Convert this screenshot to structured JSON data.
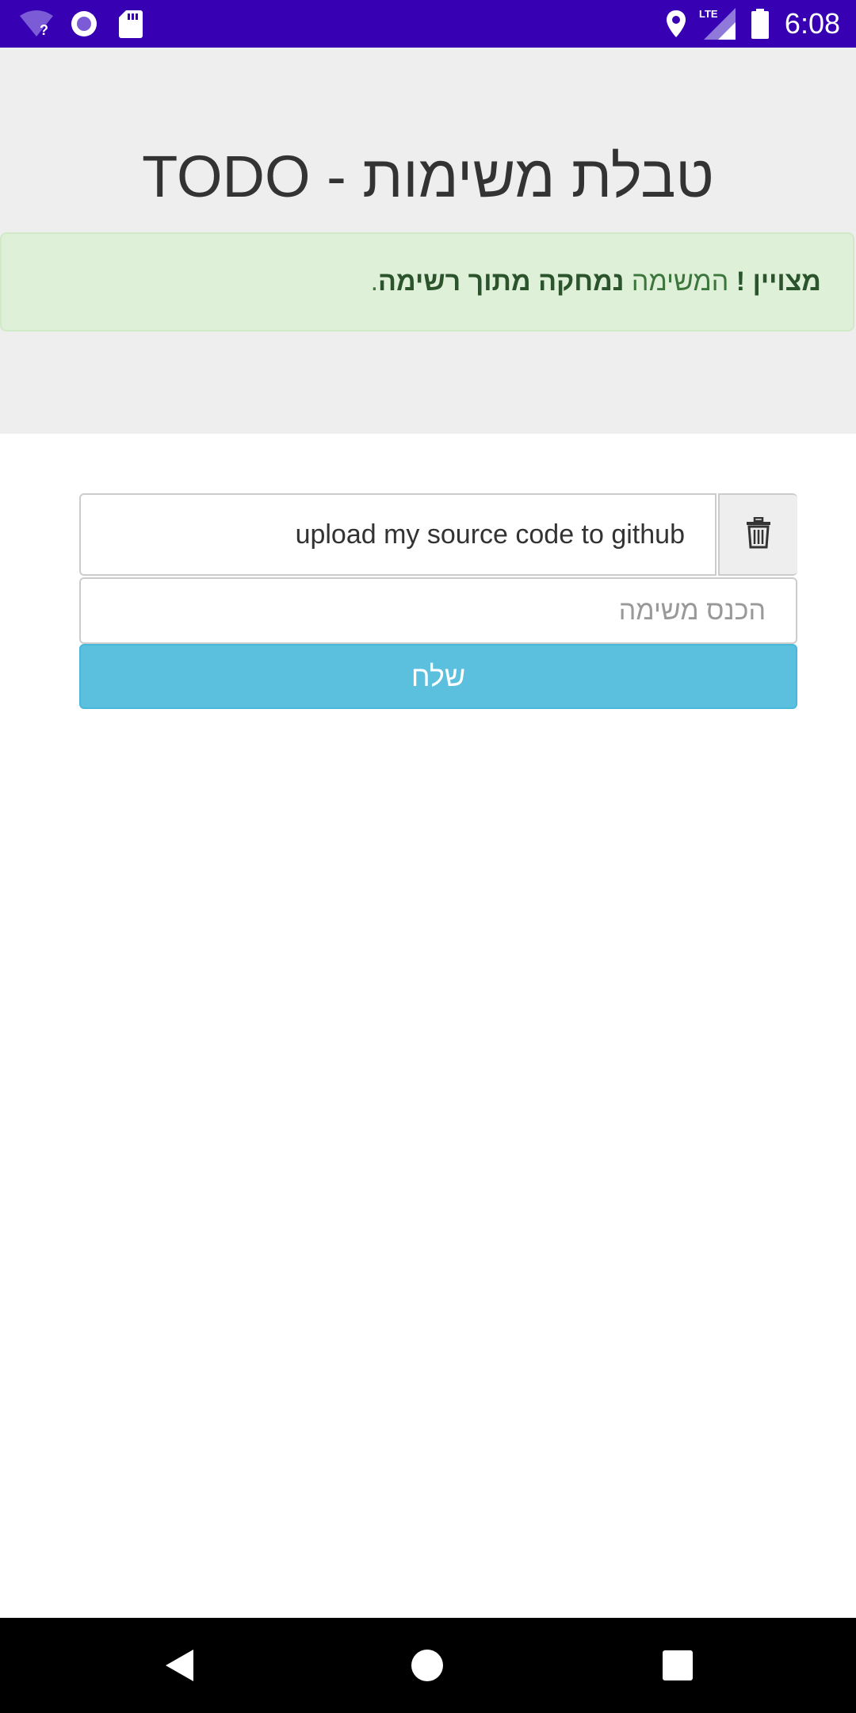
{
  "status_bar": {
    "time": "6:08",
    "network_label": "LTE",
    "background_color": "#3700b3",
    "icons": [
      "wifi-unknown-icon",
      "record-icon",
      "sd-card-icon",
      "location-icon",
      "signal-icon",
      "battery-icon"
    ]
  },
  "header": {
    "title": "TODO - טבלת משימות"
  },
  "alert": {
    "strong_prefix": "מצויין !",
    "middle_text": "המשימה",
    "strong_suffix": "נמחקה מתוך רשימה",
    "end_text": ".",
    "color": "#3c763d",
    "background": "#dff0d8"
  },
  "tasks": [
    {
      "text": "upload my source code to github",
      "delete_icon": "trash-icon"
    }
  ],
  "form": {
    "input_placeholder": "הכנס משימה",
    "input_value": "",
    "submit_label": "שלח",
    "submit_color": "#5bc0de"
  },
  "navigation": {
    "buttons": [
      "back-icon",
      "home-icon",
      "recents-icon"
    ]
  }
}
